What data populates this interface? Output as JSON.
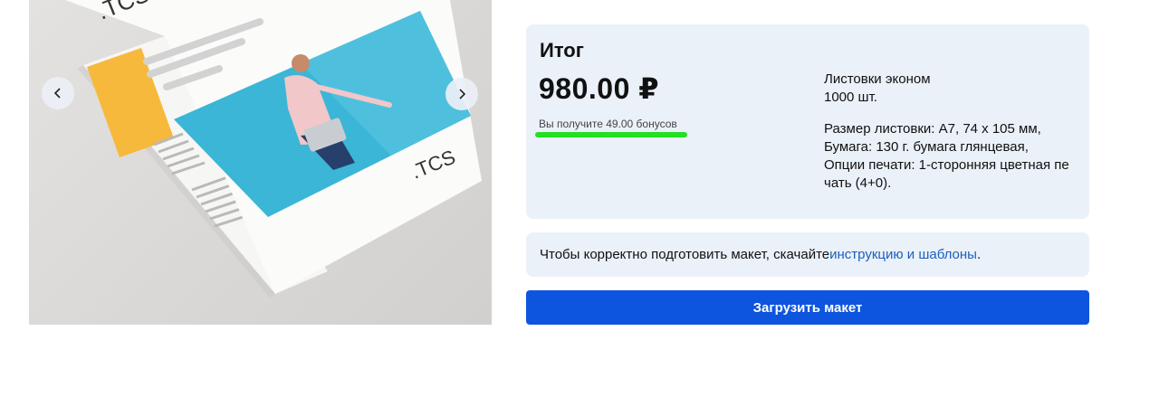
{
  "gallery": {
    "logo_text": ".TCS",
    "prev_icon": "chevron-left-icon",
    "next_icon": "chevron-right-icon"
  },
  "summary": {
    "title": "Итог",
    "price": "980.00 ₽",
    "bonus_note": "Вы получите 49.00 бонусов",
    "product_name": "Листовки эконом",
    "quantity": "1000 шт.",
    "specs": [
      "Размер листовки: А7, 74 х 105 мм,",
      "Бумага: 130 г. бумага глянцевая,",
      "Опции печати: 1-сторонняя цветная пе",
      "чать (4+0)."
    ]
  },
  "info": {
    "text": "Чтобы корректно подготовить макет, скачайте ",
    "link_text": "инструкцию и шаблоны",
    "suffix": "."
  },
  "upload_button": {
    "label": "Загрузить макет"
  },
  "colors": {
    "accent": "#0d55de",
    "panel_bg": "#ebf1f8",
    "link": "#1a5fbf",
    "highlight": "#22e022"
  }
}
